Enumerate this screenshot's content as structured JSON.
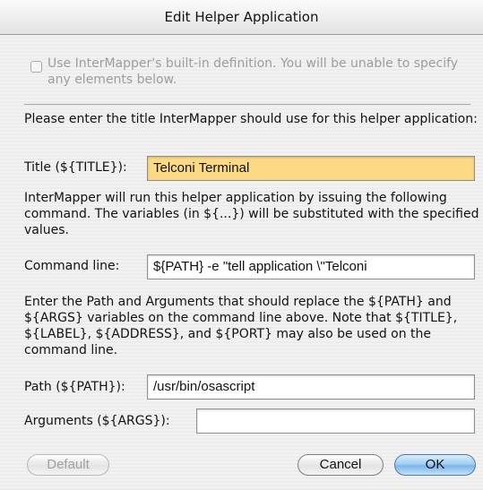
{
  "window": {
    "title": "Edit Helper Application"
  },
  "builtin": {
    "label": "Use InterMapper's built-in definition. You will be unable to specify any elements below.",
    "checked": false,
    "enabled": false
  },
  "title_section": {
    "instruction": "Please enter the title InterMapper should use for this helper application:",
    "label": "Title (${TITLE}):",
    "value": "Telconi Terminal"
  },
  "command_section": {
    "instruction": "InterMapper will run this helper application by issuing the following command. The variables (in ${...}) will be substituted with the specified values.",
    "label": "Command line:",
    "value": "${PATH} -e \"tell application \\\"Telconi"
  },
  "path_args_section": {
    "instruction": "Enter the Path and Arguments that should replace the ${PATH} and ${ARGS} variables on the command line above. Note that ${TITLE}, ${LABEL}, ${ADDRESS}, and ${PORT} may also be used on the command line.",
    "path_label": "Path (${PATH}):",
    "path_value": "/usr/bin/osascript",
    "args_label": "Arguments (${ARGS}):",
    "args_value": ""
  },
  "buttons": {
    "default_label": "Default",
    "cancel_label": "Cancel",
    "ok_label": "OK"
  },
  "colors": {
    "focused_field": "#fdd985",
    "ok_button": "#a4cff4"
  }
}
